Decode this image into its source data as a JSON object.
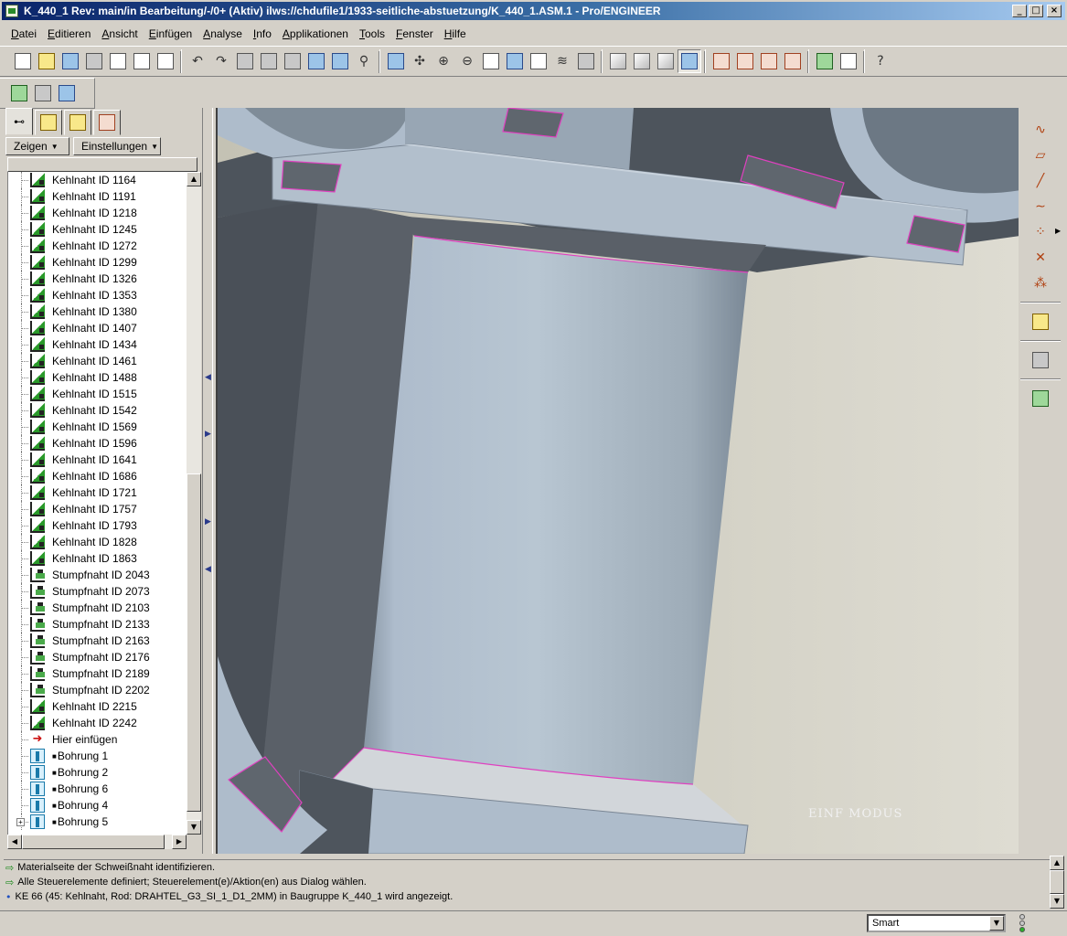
{
  "window": {
    "title": "K_440_1 Rev: main/in Bearbeitung/-/0+ (Aktiv) ilws://chdufile1/1933-seitliche-abstuetzung/K_440_1.ASM.1 - Pro/ENGINEER",
    "controls": [
      "_",
      "□",
      "×"
    ]
  },
  "menu": [
    "Datei",
    "Editieren",
    "Ansicht",
    "Einfügen",
    "Analyse",
    "Info",
    "Applikationen",
    "Tools",
    "Fenster",
    "Hilfe"
  ],
  "toolbar_groups": [
    [
      "new-icon",
      "open-icon",
      "save-icon",
      "print-icon",
      "send-icon",
      "rename-icon",
      "erase-icon"
    ],
    [
      "undo-icon",
      "redo-icon",
      "cut-icon",
      "copy-icon",
      "paste-icon",
      "regenerate-icon",
      "regenerate-manager-icon",
      "find-icon"
    ],
    [
      "repaint-icon",
      "spin-center-icon",
      "zoom-in-icon",
      "zoom-out-icon",
      "refit-icon",
      "reorient-icon",
      "saved-views-icon",
      "layers-icon",
      "view-manager-icon"
    ],
    [
      "wireframe-icon",
      "hidden-line-icon",
      "no-hidden-icon",
      "shading-icon"
    ],
    [
      "datum-planes-icon",
      "datum-axes-icon",
      "datum-points-icon",
      "coordinate-systems-icon"
    ],
    [
      "window-activate-icon",
      "window-close-icon"
    ],
    [
      "context-help-icon"
    ]
  ],
  "toolbar2": [
    "weld-path-icon",
    "weld-rod-icon",
    "weld-parameter-icon"
  ],
  "left_panel": {
    "tabs": [
      "model-tree-tab",
      "folder-browser-tab",
      "favorites-tab",
      "connections-tab"
    ],
    "show_label": "Zeigen",
    "settings_label": "Einstellungen",
    "tree": [
      {
        "type": "kehl",
        "label": "Kehlnaht ID 1164"
      },
      {
        "type": "kehl",
        "label": "Kehlnaht ID 1191"
      },
      {
        "type": "kehl",
        "label": "Kehlnaht ID 1218"
      },
      {
        "type": "kehl",
        "label": "Kehlnaht ID 1245"
      },
      {
        "type": "kehl",
        "label": "Kehlnaht ID 1272"
      },
      {
        "type": "kehl",
        "label": "Kehlnaht ID 1299"
      },
      {
        "type": "kehl",
        "label": "Kehlnaht ID 1326"
      },
      {
        "type": "kehl",
        "label": "Kehlnaht ID 1353"
      },
      {
        "type": "kehl",
        "label": "Kehlnaht ID 1380"
      },
      {
        "type": "kehl",
        "label": "Kehlnaht ID 1407"
      },
      {
        "type": "kehl",
        "label": "Kehlnaht ID 1434"
      },
      {
        "type": "kehl",
        "label": "Kehlnaht ID 1461"
      },
      {
        "type": "kehl",
        "label": "Kehlnaht ID 1488"
      },
      {
        "type": "kehl",
        "label": "Kehlnaht ID 1515"
      },
      {
        "type": "kehl",
        "label": "Kehlnaht ID 1542"
      },
      {
        "type": "kehl",
        "label": "Kehlnaht ID 1569"
      },
      {
        "type": "kehl",
        "label": "Kehlnaht ID 1596"
      },
      {
        "type": "kehl",
        "label": "Kehlnaht ID 1641"
      },
      {
        "type": "kehl",
        "label": "Kehlnaht ID 1686"
      },
      {
        "type": "kehl",
        "label": "Kehlnaht ID 1721"
      },
      {
        "type": "kehl",
        "label": "Kehlnaht ID 1757"
      },
      {
        "type": "kehl",
        "label": "Kehlnaht ID 1793"
      },
      {
        "type": "kehl",
        "label": "Kehlnaht ID 1828"
      },
      {
        "type": "kehl",
        "label": "Kehlnaht ID 1863"
      },
      {
        "type": "stumpf",
        "label": "Stumpfnaht ID 2043"
      },
      {
        "type": "stumpf",
        "label": "Stumpfnaht ID 2073"
      },
      {
        "type": "stumpf",
        "label": "Stumpfnaht ID 2103"
      },
      {
        "type": "stumpf",
        "label": "Stumpfnaht ID 2133"
      },
      {
        "type": "stumpf",
        "label": "Stumpfnaht ID 2163"
      },
      {
        "type": "stumpf",
        "label": "Stumpfnaht ID 2176"
      },
      {
        "type": "stumpf",
        "label": "Stumpfnaht ID 2189"
      },
      {
        "type": "stumpf",
        "label": "Stumpfnaht ID 2202"
      },
      {
        "type": "kehl",
        "label": "Kehlnaht ID 2215"
      },
      {
        "type": "kehl",
        "label": "Kehlnaht ID 2242"
      },
      {
        "type": "insert",
        "label": "Hier einfügen"
      },
      {
        "type": "hole",
        "label": "Bohrung 1"
      },
      {
        "type": "hole",
        "label": "Bohrung 2"
      },
      {
        "type": "hole",
        "label": "Bohrung 6"
      },
      {
        "type": "hole",
        "label": "Bohrung 4"
      },
      {
        "type": "hole",
        "label": "Bohrung 5",
        "expander": "+"
      }
    ]
  },
  "viewport": {
    "mode_label": "EINF MODUS",
    "highlight_color": "#e040c0",
    "background_color": "#cfcdc0",
    "part_color": "#b4c4d0"
  },
  "right_toolbar": [
    "datum-curve-sketch-icon",
    "datum-plane-icon",
    "datum-axis-icon",
    "datum-curve-icon",
    "datum-point-icon",
    "datum-csys-icon",
    "analysis-icon",
    "annotation-icon",
    "table-icon",
    "weld-icon"
  ],
  "messages": [
    {
      "kind": "prompt",
      "text": "Materialseite der Schweißnaht identifizieren."
    },
    {
      "kind": "prompt",
      "text": "Alle Steuerelemente definiert; Steuerelement(e)/Aktion(en) aus Dialog wählen."
    },
    {
      "kind": "info",
      "text": "KE 66 (45: Kehlnaht, Rod: DRAHTEL_G3_SI_1_D1_2MM) in Baugruppe K_440_1 wird angezeigt."
    }
  ],
  "status": {
    "filter_value": "Smart"
  }
}
